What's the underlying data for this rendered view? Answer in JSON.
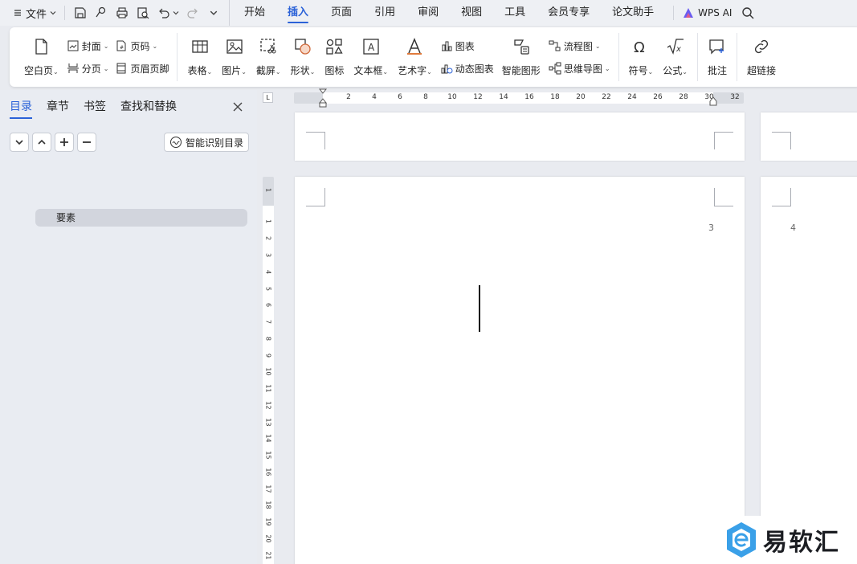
{
  "menubar": {
    "file_label": "文件",
    "tabs": [
      "开始",
      "插入",
      "页面",
      "引用",
      "审阅",
      "视图",
      "工具",
      "会员专享",
      "论文助手"
    ],
    "active_tab": "插入",
    "wps_ai_label": "WPS AI"
  },
  "ribbon": {
    "blank_page": "空白页",
    "cover": "封面",
    "page_break": "分页",
    "page_number": "页码",
    "header_footer": "页眉页脚",
    "table": "表格",
    "picture": "图片",
    "screenshot": "截屏",
    "shape": "形状",
    "icon": "图标",
    "textbox": "文本框",
    "wordart": "艺术字",
    "chart": "图表",
    "dynamic_chart": "动态图表",
    "smart_graphic": "智能图形",
    "flowchart": "流程图",
    "mindmap": "思维导图",
    "symbol": "符号",
    "formula": "公式",
    "comment": "批注",
    "hyperlink": "超链接"
  },
  "navpane": {
    "tabs": [
      "目录",
      "章节",
      "书签",
      "查找和替换"
    ],
    "active_tab": "目录",
    "smart_toc_label": "智能识别目录",
    "toc_items": [
      "要素"
    ]
  },
  "ruler": {
    "corner_label": "L",
    "h_ticks": [
      "2",
      "4",
      "6",
      "8",
      "10",
      "12",
      "14",
      "16",
      "18",
      "20",
      "22",
      "24",
      "26",
      "28",
      "30",
      "32"
    ],
    "v_ticks": [
      "1",
      "1",
      "2",
      "3",
      "4",
      "5",
      "6",
      "7",
      "8",
      "9",
      "10",
      "11",
      "12",
      "13",
      "14",
      "15",
      "16",
      "17",
      "18",
      "19",
      "20",
      "21"
    ]
  },
  "document": {
    "page_number_left": "3",
    "page_number_right": "4"
  },
  "watermark": {
    "text": "易软汇"
  }
}
